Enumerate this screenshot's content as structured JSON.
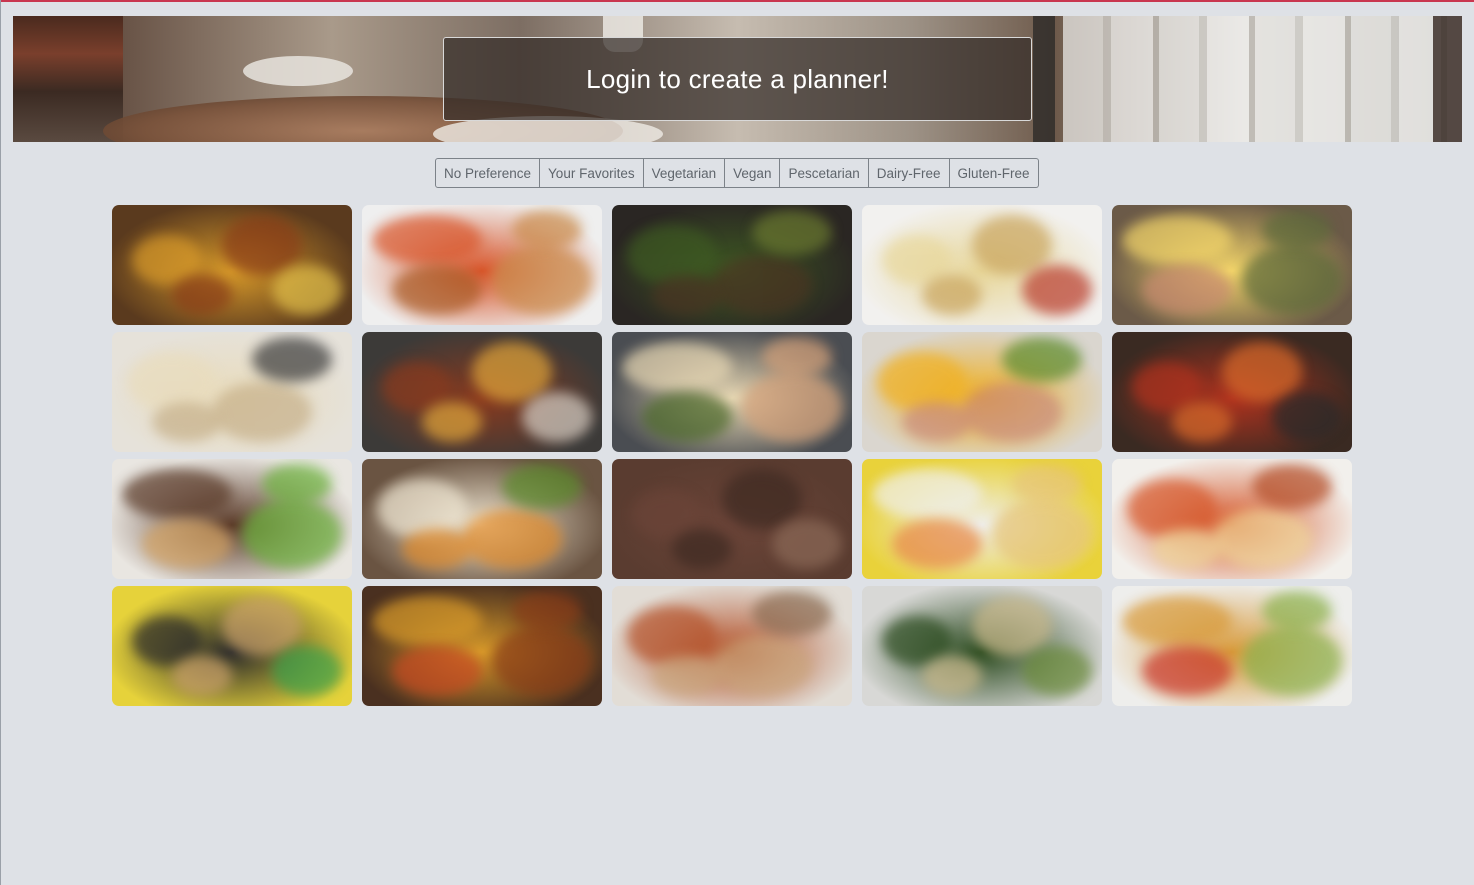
{
  "hero": {
    "login_text": "Login to create a planner!"
  },
  "filters": [
    {
      "label": "No Preference"
    },
    {
      "label": "Your Favorites"
    },
    {
      "label": "Vegetarian"
    },
    {
      "label": "Vegan"
    },
    {
      "label": "Pescetarian"
    },
    {
      "label": "Dairy-Free"
    },
    {
      "label": "Gluten-Free"
    }
  ],
  "recipes": [
    {
      "name": "roast-chicken-vegetables",
      "base": "#5a3a1e",
      "c1": "#d89a2a",
      "c2": "#8a3d18",
      "c3": "#e2c04a"
    },
    {
      "name": "tomato-soup-grilled-cheese",
      "base": "#efefef",
      "c1": "#d8552a",
      "c2": "#c98a4a",
      "c3": "#a85a24"
    },
    {
      "name": "beef-broccoli",
      "base": "#2a2623",
      "c1": "#3e5a22",
      "c2": "#4a3422",
      "c3": "#6b7a30"
    },
    {
      "name": "spaghetti-carbonara",
      "base": "#f2f1ef",
      "c1": "#e8d79a",
      "c2": "#c9a45c",
      "c3": "#b83a2a"
    },
    {
      "name": "lemon-herb-salmon",
      "base": "#6b5a48",
      "c1": "#f4d66a",
      "c2": "#5c6a3a",
      "c3": "#c98a70"
    },
    {
      "name": "chicken-alfredo",
      "base": "#e6e2da",
      "c1": "#e9dcbc",
      "c2": "#c6b08a",
      "c3": "#3a3a3a"
    },
    {
      "name": "chili-bowl",
      "base": "#3c3a38",
      "c1": "#8a3a1e",
      "c2": "#e0a53a",
      "c3": "#d8d0c6"
    },
    {
      "name": "shrimp-fettuccine",
      "base": "#4a4d52",
      "c1": "#e8d8b4",
      "c2": "#d6a27a",
      "c3": "#4c6a2a"
    },
    {
      "name": "ham-cheese-omelette",
      "base": "#dad6cf",
      "c1": "#f0b020",
      "c2": "#c98a7a",
      "c3": "#5a8a2a"
    },
    {
      "name": "chicken-cacciatore",
      "base": "#3a2a22",
      "c1": "#b0321e",
      "c2": "#d86a2a",
      "c3": "#2a2a2a"
    },
    {
      "name": "veggie-burger",
      "base": "#e9e6e1",
      "c1": "#5a3a28",
      "c2": "#6ab03a",
      "c3": "#d3a262"
    },
    {
      "name": "vegetable-quesadilla",
      "base": "#6a5442",
      "c1": "#efe6d2",
      "c2": "#e08a2a",
      "c3": "#5a8a2a"
    },
    {
      "name": "salisbury-steak",
      "base": "#5a3c30",
      "c1": "#6b4438",
      "c2": "#3e2a22",
      "c3": "#8c6a58"
    },
    {
      "name": "shrimp-scampi-pasta",
      "base": "#e9d23a",
      "c1": "#efefed",
      "c2": "#e6c47a",
      "c3": "#e8874a"
    },
    {
      "name": "chicken-parmesan",
      "base": "#f2f0ec",
      "c1": "#d6572a",
      "c2": "#efd69a",
      "c3": "#b24a24"
    },
    {
      "name": "vegetable-fried-rice",
      "base": "#e6d23a",
      "c1": "#2a2a2a",
      "c2": "#c9a06a",
      "c3": "#3aa04a"
    },
    {
      "name": "roast-chicken-vegetables-2",
      "base": "#4a3020",
      "c1": "#d89a2a",
      "c2": "#8a3d18",
      "c3": "#c84a22"
    },
    {
      "name": "beef-stroganoff",
      "base": "#e2ddd6",
      "c1": "#b4522a",
      "c2": "#c9a57c",
      "c3": "#8a6a50"
    },
    {
      "name": "caesar-salad",
      "base": "#d8d8d6",
      "c1": "#2a4a1e",
      "c2": "#c9b88a",
      "c3": "#6a8a3a"
    },
    {
      "name": "fish-tacos",
      "base": "#eeeeec",
      "c1": "#d89a3a",
      "c2": "#8ab04a",
      "c3": "#c9362a"
    }
  ]
}
